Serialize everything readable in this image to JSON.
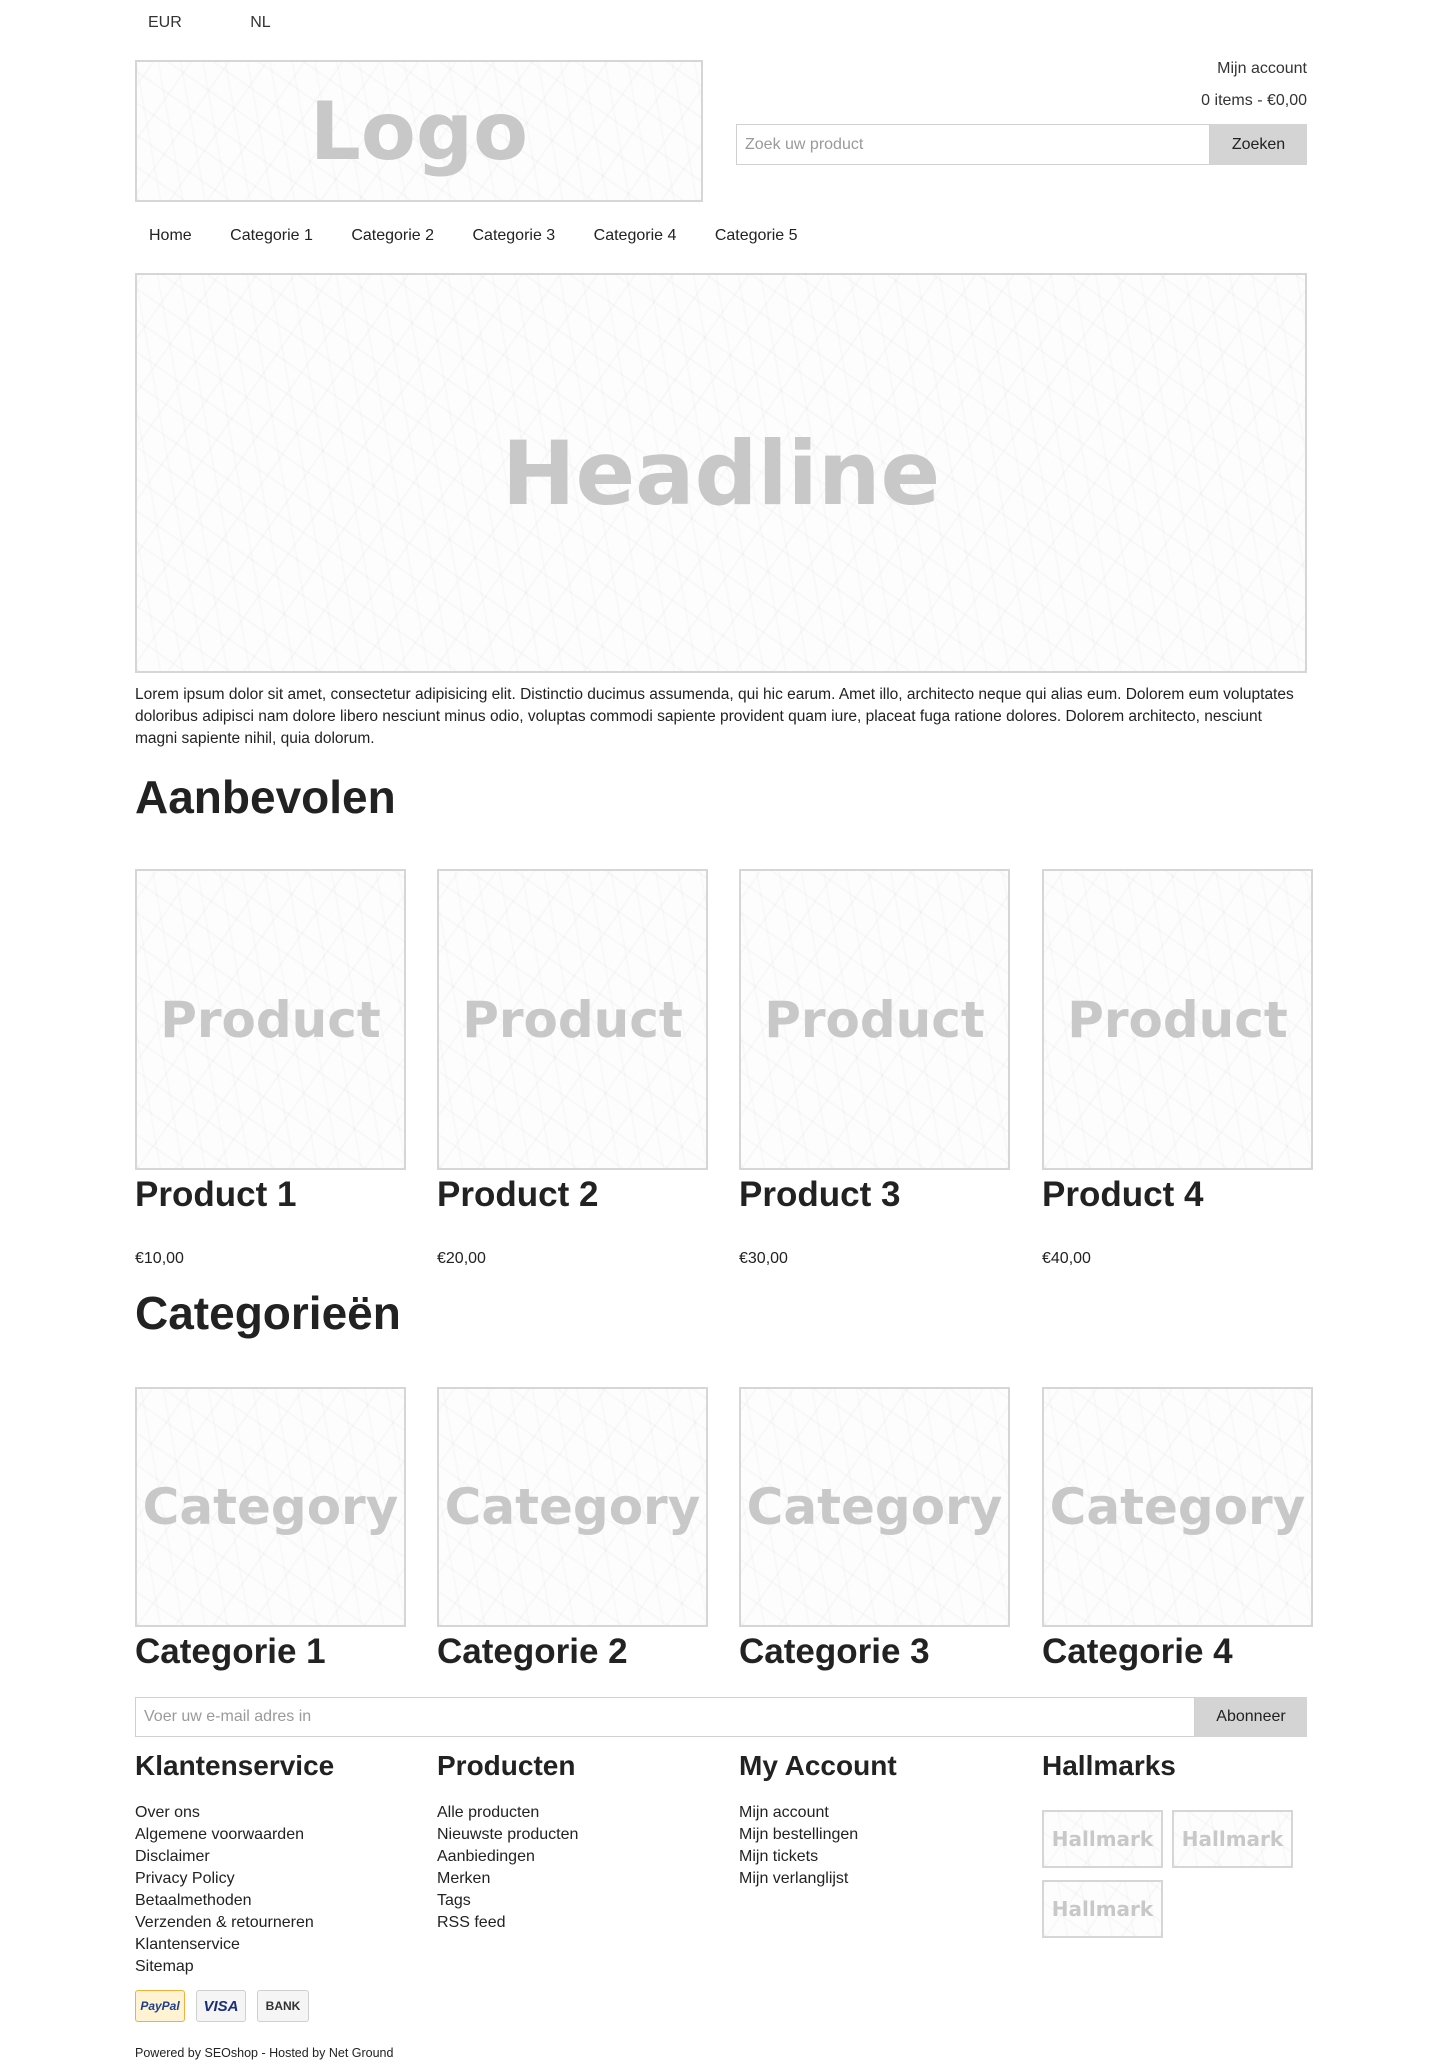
{
  "topbar": {
    "currency": "EUR",
    "language": "NL"
  },
  "header": {
    "logo_text": "Logo",
    "account_link": "Mijn account",
    "cart_summary": "0 items - €0,00",
    "search_placeholder": "Zoek uw product",
    "search_button": "Zoeken"
  },
  "nav": [
    "Home",
    "Categorie 1",
    "Categorie 2",
    "Categorie 3",
    "Categorie 4",
    "Categorie 5"
  ],
  "hero": {
    "headline": "Headline"
  },
  "intro_text": "Lorem ipsum dolor sit amet, consectetur adipisicing elit. Distinctio ducimus assumenda, qui hic earum. Amet illo, architecto neque qui alias eum. Dolorem eum voluptates doloribus adipisci nam dolore libero nesciunt minus odio, voluptas commodi sapiente provident quam iure, placeat fuga ratione dolores. Dolorem architecto, nesciunt magni sapiente nihil, quia dolorum.",
  "featured": {
    "heading": "Aanbevolen",
    "products": [
      {
        "image_text": "Product",
        "name": "Product 1",
        "price": "€10,00"
      },
      {
        "image_text": "Product",
        "name": "Product 2",
        "price": "€20,00"
      },
      {
        "image_text": "Product",
        "name": "Product 3",
        "price": "€30,00"
      },
      {
        "image_text": "Product",
        "name": "Product 4",
        "price": "€40,00"
      }
    ]
  },
  "categories": {
    "heading": "Categorieën",
    "items": [
      {
        "image_text": "Category",
        "name": "Categorie 1"
      },
      {
        "image_text": "Category",
        "name": "Categorie 2"
      },
      {
        "image_text": "Category",
        "name": "Categorie 3"
      },
      {
        "image_text": "Category",
        "name": "Categorie 4"
      }
    ]
  },
  "newsletter": {
    "placeholder": "Voer uw e-mail adres in",
    "button": "Abonneer"
  },
  "footer": {
    "columns": [
      {
        "heading": "Klantenservice",
        "links": [
          "Over ons",
          "Algemene voorwaarden",
          "Disclaimer",
          "Privacy Policy",
          "Betaalmethoden",
          "Verzenden & retourneren",
          "Klantenservice",
          "Sitemap"
        ]
      },
      {
        "heading": "Producten",
        "links": [
          "Alle producten",
          "Nieuwste producten",
          "Aanbiedingen",
          "Merken",
          "Tags",
          "RSS feed"
        ]
      },
      {
        "heading": "My Account",
        "links": [
          "Mijn account",
          "Mijn bestellingen",
          "Mijn tickets",
          "Mijn verlanglijst"
        ]
      }
    ],
    "hallmarks": {
      "heading": "Hallmarks",
      "items": [
        "Hallmark",
        "Hallmark",
        "Hallmark"
      ]
    },
    "payment_methods": [
      "PayPal",
      "VISA",
      "BANK"
    ],
    "powered_by": "Powered by SEOshop - Hosted by Net Ground"
  }
}
